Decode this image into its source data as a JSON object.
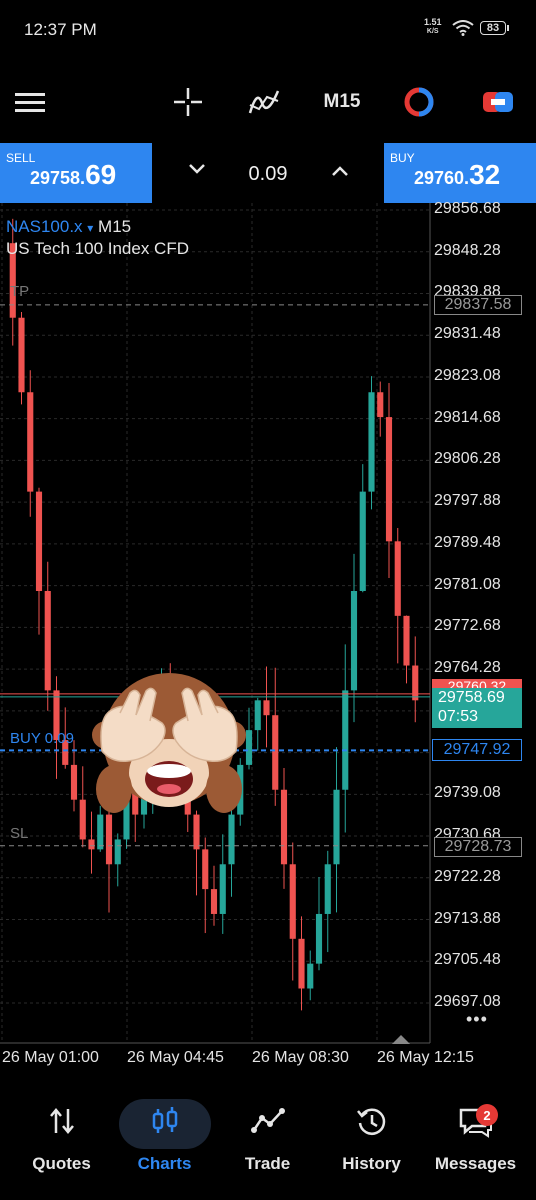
{
  "status": {
    "time": "12:37 PM",
    "net_speed": "1.51",
    "net_unit": "K/S",
    "battery": "83"
  },
  "toolbar": {
    "timeframe": "M15",
    "icons": [
      "menu-icon",
      "crosshair-icon",
      "indicators-icon",
      "timeframe",
      "color-icon",
      "object-icon"
    ]
  },
  "trade": {
    "sell_label": "SELL",
    "sell_main": "29758.",
    "sell_big": "69",
    "buy_label": "BUY",
    "buy_main": "29760.",
    "buy_big": "32",
    "volume": "0.09"
  },
  "chart": {
    "symbol": "NAS100.x",
    "symbol_arrow": "▾",
    "timeframe": "M15",
    "description": "US Tech 100 Index CFD",
    "tp_label": "TP",
    "sl_label": "SL",
    "buy_line_label": "BUY 0.09",
    "price_labels": [
      "29856.68",
      "29848.28",
      "29839.88",
      "29831.48",
      "29823.08",
      "29814.68",
      "29806.28",
      "29797.88",
      "29789.48",
      "29781.08",
      "29772.68",
      "29764.28",
      "29756.88",
      "29747.48",
      "29739.08",
      "29730.68",
      "29722.28",
      "29713.88",
      "29705.48",
      "29697.08"
    ],
    "tp_price": "29837.58",
    "bid_price": "29758.69",
    "bid_timer": "07:53",
    "ask_partial": "29760.32",
    "buy_price": "29747.92",
    "sl_price": "29728.73",
    "time_labels": [
      "26 May 01:00",
      "26 May 04:45",
      "26 May 08:30",
      "26 May 12:15"
    ],
    "more": "•••",
    "colors": {
      "bull": "#26a69a",
      "bear": "#ef5350",
      "grid": "#2a2a2a",
      "blue": "#2e86f0"
    }
  },
  "chart_data": {
    "type": "candlestick",
    "title": "NAS100.x M15",
    "subtitle": "US Tech 100 Index CFD",
    "ylim": [
      29693,
      29860
    ],
    "x": [
      "26 May 01:00",
      "26 May 04:45",
      "26 May 08:30",
      "26 May 12:15"
    ],
    "levels": {
      "TP": 29837.58,
      "BUY 0.09": 29747.92,
      "SL": 29728.73,
      "bid": 29758.69
    }
  },
  "nav": {
    "items": [
      {
        "label": "Quotes",
        "icon": "quotes-icon"
      },
      {
        "label": "Charts",
        "icon": "charts-icon"
      },
      {
        "label": "Trade",
        "icon": "trade-icon"
      },
      {
        "label": "History",
        "icon": "history-icon"
      },
      {
        "label": "Messages",
        "icon": "messages-icon"
      }
    ],
    "badge": "2"
  }
}
